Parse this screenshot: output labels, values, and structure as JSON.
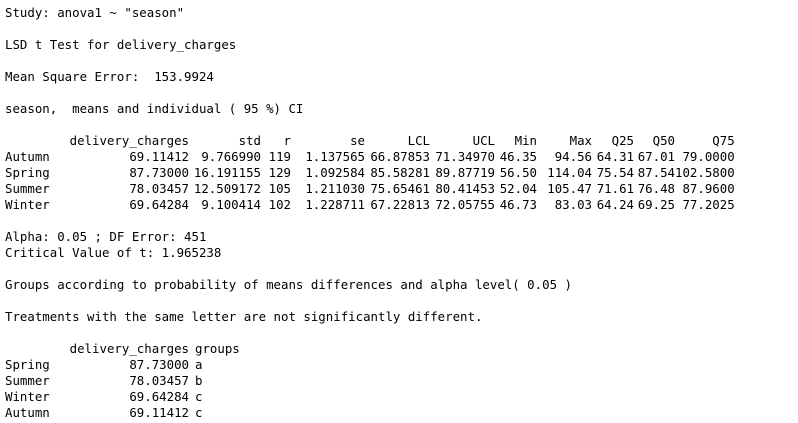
{
  "console": {
    "study_line": "Study: anova1 ~ \"season\"",
    "test_title": "LSD t Test for delivery_charges",
    "mse_line": "Mean Square Error:  153.9924",
    "ci_line": "season,  means and individual ( 95 %) CI",
    "alpha_line": "Alpha: 0.05 ; DF Error: 451",
    "critical_line": "Critical Value of t: 1.965238",
    "groups_note": "Groups according to probability of means differences and alpha level( 0.05 )",
    "treatments_note": "Treatments with the same letter are not significantly different."
  },
  "stats_table": {
    "headers": [
      "delivery_charges",
      "std",
      "r",
      "se",
      "LCL",
      "UCL",
      "Min",
      "Max",
      "Q25",
      "Q50",
      "Q75"
    ],
    "rows": [
      {
        "name": "Autumn",
        "cells": [
          "69.11412",
          "9.766990",
          "119",
          "1.137565",
          "66.87853",
          "71.34970",
          "46.35",
          "94.56",
          "64.31",
          "67.01",
          "79.0000"
        ]
      },
      {
        "name": "Spring",
        "cells": [
          "87.73000",
          "16.191155",
          "129",
          "1.092584",
          "85.58281",
          "89.87719",
          "56.50",
          "114.04",
          "75.54",
          "87.54",
          "102.5800"
        ]
      },
      {
        "name": "Summer",
        "cells": [
          "78.03457",
          "12.509172",
          "105",
          "1.211030",
          "75.65461",
          "80.41453",
          "52.04",
          "105.47",
          "71.61",
          "76.48",
          "87.9600"
        ]
      },
      {
        "name": "Winter",
        "cells": [
          "69.64284",
          "9.100414",
          "102",
          "1.228711",
          "67.22813",
          "72.05755",
          "46.73",
          "83.03",
          "64.24",
          "69.25",
          "77.2025"
        ]
      }
    ]
  },
  "groups_table": {
    "headers": [
      "delivery_charges",
      "groups"
    ],
    "rows": [
      {
        "name": "Spring",
        "value": "87.73000",
        "group": "a"
      },
      {
        "name": "Summer",
        "value": "78.03457",
        "group": "b"
      },
      {
        "name": "Winter",
        "value": "69.64284",
        "group": "c"
      },
      {
        "name": "Autumn",
        "value": "69.11412",
        "group": "c"
      }
    ]
  }
}
